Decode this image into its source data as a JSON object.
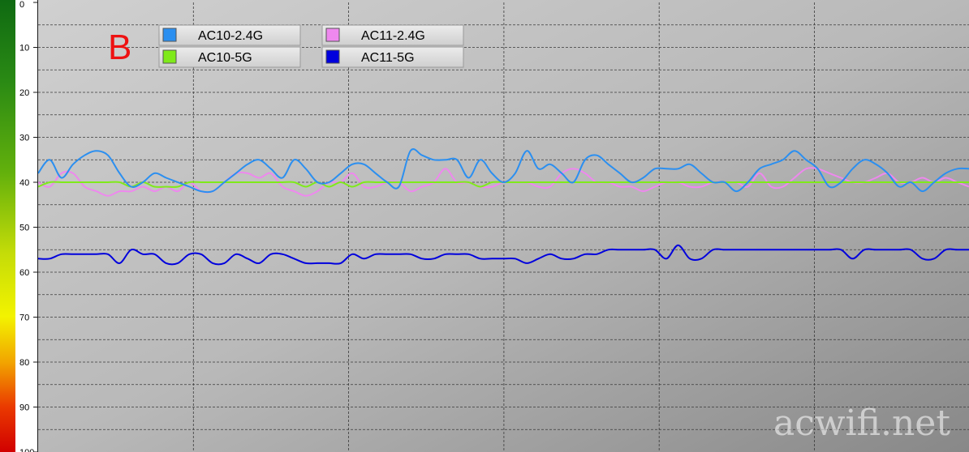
{
  "label": "B",
  "watermark": "acwifi.net",
  "chart_data": {
    "type": "line",
    "ylim": [
      0,
      100
    ],
    "y_inverted": true,
    "y_ticks": [
      "0",
      "10",
      "20",
      "30",
      "40",
      "50",
      "60",
      "70",
      "80",
      "90",
      "100"
    ],
    "grid": true,
    "legend_position": "top-left",
    "series": [
      {
        "name": "AC10-2.4G",
        "color": "#2b8ff0",
        "values": [
          38,
          35,
          39,
          36,
          34,
          33,
          34,
          38,
          41,
          40,
          38,
          39,
          40,
          41,
          42,
          42,
          40,
          38,
          36,
          35,
          37,
          39,
          35,
          37,
          40,
          40,
          38,
          36,
          36,
          38,
          40,
          41,
          33,
          34,
          35,
          35,
          35,
          39,
          35,
          38,
          40,
          38,
          33,
          37,
          36,
          38,
          40,
          35,
          34,
          36,
          38,
          40,
          39,
          37,
          37,
          37,
          36,
          38,
          40,
          40,
          42,
          40,
          37,
          36,
          35,
          33,
          35,
          37,
          41,
          40,
          37,
          35,
          36,
          38,
          41,
          40,
          42,
          40,
          38,
          37,
          37
        ]
      },
      {
        "name": "AC11-2.4G",
        "color": "#ee88ee",
        "values": [
          40,
          41,
          38,
          38,
          41,
          42,
          43,
          42,
          42,
          41,
          42,
          41,
          42,
          40,
          42,
          42,
          40,
          38,
          38,
          39,
          38,
          41,
          42,
          43,
          42,
          40,
          40,
          38,
          41,
          41,
          40,
          40,
          42,
          41,
          40,
          37,
          40,
          40,
          41,
          41,
          40,
          40,
          40,
          41,
          41,
          38,
          37,
          38,
          40,
          40,
          41,
          41,
          42,
          41,
          40,
          40,
          41,
          41,
          40,
          40,
          40,
          41,
          38,
          41,
          41,
          39,
          37,
          37,
          38,
          39,
          40,
          40,
          39,
          38,
          40,
          40,
          39,
          40,
          39,
          40,
          41
        ]
      },
      {
        "name": "AC10-5G",
        "color": "#7fea1a",
        "values": [
          41,
          40,
          40,
          40,
          40,
          40,
          40,
          40,
          41,
          40,
          41,
          41,
          41,
          40,
          40,
          40,
          40,
          40,
          40,
          40,
          40,
          40,
          40,
          41,
          40,
          41,
          40,
          41,
          40,
          40,
          40,
          40,
          40,
          40,
          40,
          40,
          40,
          40,
          41,
          40,
          40,
          40,
          40,
          40,
          40,
          40,
          40,
          40,
          40,
          40,
          40,
          40,
          40,
          40,
          40,
          40,
          40,
          40,
          40,
          40,
          40,
          40,
          40,
          40,
          40,
          40,
          40,
          40,
          40,
          40,
          40,
          40,
          40,
          40,
          40,
          40,
          40,
          40,
          40,
          40,
          40
        ]
      },
      {
        "name": "AC11-5G",
        "color": "#0000dd",
        "values": [
          57,
          57,
          56,
          56,
          56,
          56,
          56,
          58,
          55,
          56,
          56,
          58,
          58,
          56,
          56,
          58,
          58,
          56,
          57,
          58,
          56,
          56,
          57,
          58,
          58,
          58,
          58,
          56,
          57,
          56,
          56,
          56,
          56,
          57,
          57,
          56,
          56,
          56,
          57,
          57,
          57,
          57,
          58,
          57,
          56,
          57,
          57,
          56,
          56,
          55,
          55,
          55,
          55,
          55,
          57,
          54,
          57,
          57,
          55,
          55,
          55,
          55,
          55,
          55,
          55,
          55,
          55,
          55,
          55,
          55,
          57,
          55,
          55,
          55,
          55,
          55,
          57,
          57,
          55,
          55,
          55
        ]
      }
    ]
  }
}
